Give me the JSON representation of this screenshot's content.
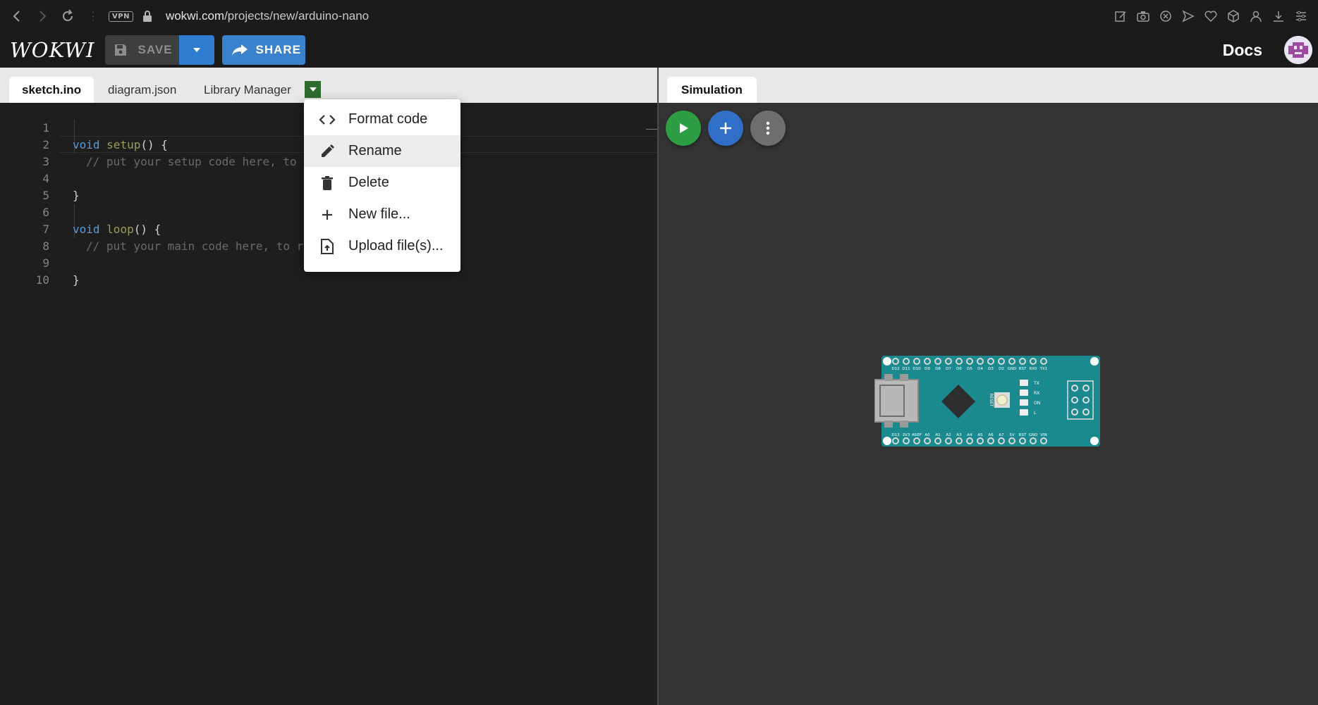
{
  "browser": {
    "vpn_label": "VPN",
    "url_domain": "wokwi.com",
    "url_path": "/projects/new/arduino-nano"
  },
  "header": {
    "logo": "WOKWI",
    "save_label": "SAVE",
    "share_label": "SHARE",
    "docs_label": "Docs"
  },
  "editor": {
    "tabs": [
      "sketch.ino",
      "diagram.json",
      "Library Manager"
    ],
    "active_tab": "sketch.ino",
    "line_numbers": [
      "1",
      "2",
      "3",
      "4",
      "5",
      "6",
      "7",
      "8",
      "9",
      "10"
    ],
    "lines": [
      {
        "kw": "void",
        "fn": "setup",
        "rest": "() {"
      },
      {
        "comment": "// put your setup code here, to"
      },
      {},
      {
        "rest": "}"
      },
      {},
      {
        "kw": "void",
        "fn": "loop",
        "rest": "() {"
      },
      {
        "comment": "// put your main code here, to r"
      },
      {},
      {
        "rest": "}"
      },
      {}
    ]
  },
  "menu": {
    "items": [
      {
        "label": "Format code",
        "icon": "code-icon"
      },
      {
        "label": "Rename",
        "icon": "pencil-icon"
      },
      {
        "label": "Delete",
        "icon": "trash-icon"
      },
      {
        "label": "New file...",
        "icon": "plus-icon"
      },
      {
        "label": "Upload file(s)...",
        "icon": "upload-file-icon"
      }
    ],
    "highlighted": "Rename"
  },
  "simulation": {
    "tab_label": "Simulation",
    "board": {
      "top_pins": [
        "D12",
        "D11",
        "D10",
        "D9",
        "D8",
        "D7",
        "D6",
        "D5",
        "D4",
        "D3",
        "D2",
        "GND",
        "RST",
        "RX0",
        "TX1"
      ],
      "bottom_pins": [
        "D13",
        "3V3",
        "AREF",
        "A0",
        "A1",
        "A2",
        "A3",
        "A4",
        "A5",
        "A6",
        "A7",
        "5V",
        "RST",
        "GND",
        "VIN"
      ],
      "reset_label": "RESET",
      "led_labels": [
        "TX",
        "RX",
        "ON",
        "L"
      ]
    }
  },
  "colors": {
    "accent_blue": "#3b82cc",
    "run_green": "#2e9e44",
    "menu_toggle_green": "#2e6b2e",
    "board_teal": "#1b8a8f"
  }
}
